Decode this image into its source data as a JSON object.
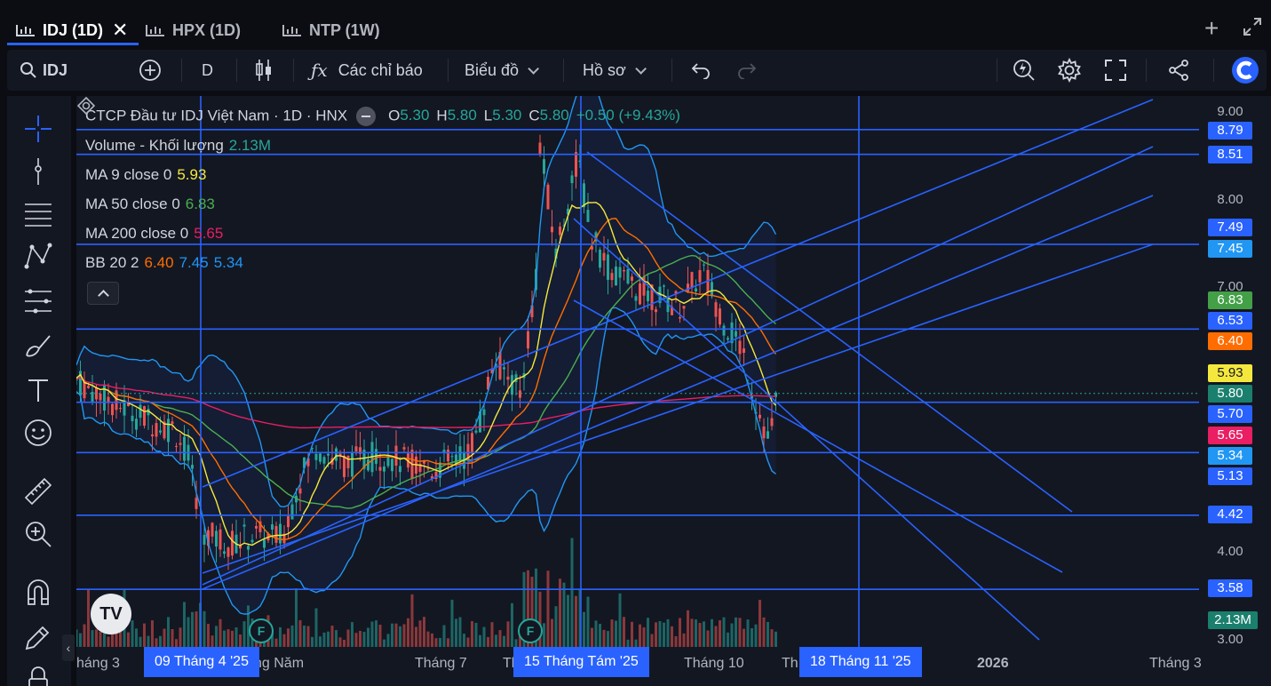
{
  "tabs": [
    {
      "label": "IDJ (1D)",
      "active": true
    },
    {
      "label": "HPX (1D)",
      "active": false
    },
    {
      "label": "NTP (1W)",
      "active": false
    }
  ],
  "toolbar": {
    "symbol": "IDJ",
    "interval": "D",
    "indicators_label": "Các chỉ báo",
    "chart_label": "Biểu đồ",
    "profile_label": "Hồ sơ"
  },
  "legend": {
    "title": "CTCP Đầu tư IDJ Việt Nam · 1D · HNX",
    "ohlc": {
      "o": "5.30",
      "h": "5.80",
      "l": "5.30",
      "c": "5.80",
      "change": "+0.50 (+9.43%)"
    },
    "volume": {
      "label": "Volume - Khối lượng",
      "value": "2.13M"
    },
    "ma9": {
      "label": "MA 9 close 0",
      "value": "5.93"
    },
    "ma50": {
      "label": "MA 50 close 0",
      "value": "6.83"
    },
    "ma200": {
      "label": "MA 200 close 0",
      "value": "5.65"
    },
    "bb": {
      "label": "BB 20 2",
      "upper": "6.40",
      "middle": "7.45",
      "lower": "5.34"
    }
  },
  "colors": {
    "up": "#26a69a",
    "down": "#ef5350",
    "ma9": "#f5e83d",
    "ma50": "#4caf50",
    "ma200": "#e91e63",
    "bb_upper": "#ff6d00",
    "bb_mid": "#2196f3",
    "drawing": "#2962ff"
  },
  "price_axis": {
    "ticks": [
      "9.00",
      "8.00",
      "7.00",
      "4.00",
      "3.00"
    ],
    "labels": [
      {
        "text": "8.79",
        "color": "#2962ff"
      },
      {
        "text": "8.51",
        "color": "#2962ff"
      },
      {
        "text": "7.49",
        "color": "#2962ff"
      },
      {
        "text": "7.45",
        "color": "#2196f3"
      },
      {
        "text": "6.83",
        "color": "#43a047"
      },
      {
        "text": "6.53",
        "color": "#2962ff"
      },
      {
        "text": "6.40",
        "color": "#ff6d00"
      },
      {
        "text": "5.93",
        "color": "#f5e83d"
      },
      {
        "text": "5.80",
        "color": "#1b7f6e"
      },
      {
        "text": "5.70",
        "color": "#2962ff"
      },
      {
        "text": "5.65",
        "color": "#e91e63"
      },
      {
        "text": "5.34",
        "color": "#2196f3"
      },
      {
        "text": "5.13",
        "color": "#2962ff"
      },
      {
        "text": "4.42",
        "color": "#2962ff"
      },
      {
        "text": "3.58",
        "color": "#2962ff"
      },
      {
        "text": "2.13M",
        "color": "#1b7f6e"
      }
    ]
  },
  "time_axis": {
    "ticks": [
      "háng 3",
      "ng Năm",
      "Tháng 7",
      "Th",
      "Tháng 10",
      "Th",
      "2026",
      "Tháng 3"
    ],
    "highlights": [
      "09 Tháng 4 '25",
      "15 Tháng Tám '25",
      "18 Tháng 11 '25"
    ]
  },
  "markers": [
    "F",
    "F"
  ]
}
